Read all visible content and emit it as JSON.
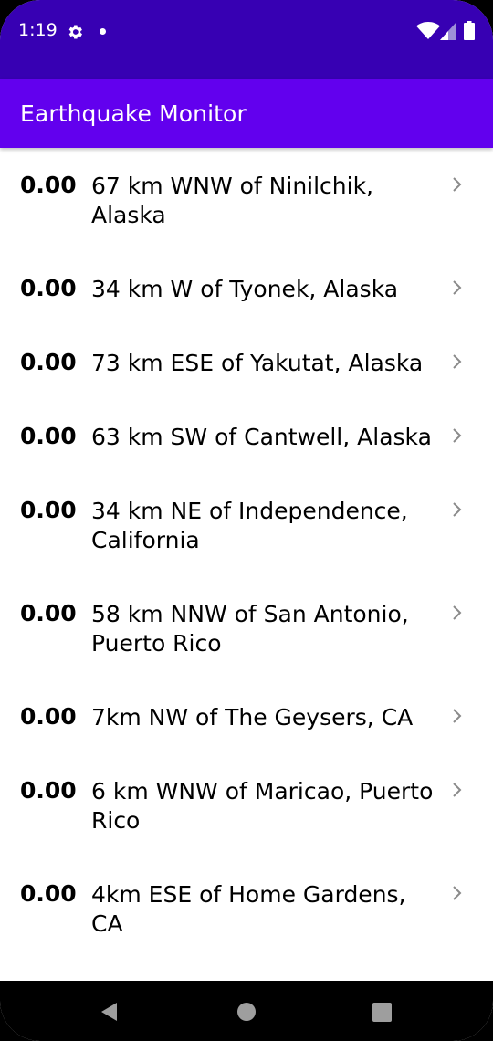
{
  "status_bar": {
    "time": "1:19",
    "icons": [
      "gear-icon",
      "notification-dot-icon",
      "wifi-icon",
      "signal-icon",
      "battery-icon"
    ],
    "background": "#3700b3"
  },
  "app_bar": {
    "title": "Earthquake Monitor",
    "background": "#6200ee"
  },
  "earthquakes": [
    {
      "magnitude": "0.00",
      "place": "67 km WNW of Ninilchik, Alaska"
    },
    {
      "magnitude": "0.00",
      "place": "34 km W of Tyonek, Alaska"
    },
    {
      "magnitude": "0.00",
      "place": "73 km ESE of Yakutat, Alaska"
    },
    {
      "magnitude": "0.00",
      "place": "63 km SW of Cantwell, Alaska"
    },
    {
      "magnitude": "0.00",
      "place": "34 km NE of Independence, California"
    },
    {
      "magnitude": "0.00",
      "place": "58 km NNW of San Antonio, Puerto Rico"
    },
    {
      "magnitude": "0.00",
      "place": "7km NW of The Geysers, CA"
    },
    {
      "magnitude": "0.00",
      "place": "6 km WNW of Maricao, Puerto Rico"
    },
    {
      "magnitude": "0.00",
      "place": "4km ESE of Home Gardens, CA"
    }
  ],
  "nav_bar": {
    "icons": [
      "back-icon",
      "home-icon",
      "recents-icon"
    ]
  }
}
